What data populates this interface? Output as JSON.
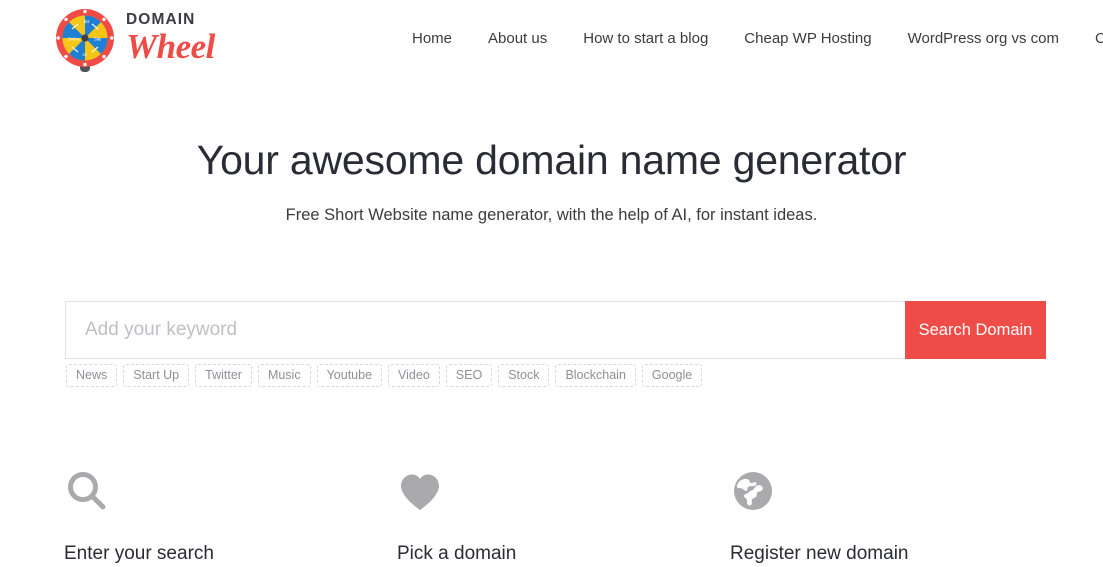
{
  "header": {
    "brand": {
      "word_top": "DOMAIN",
      "word_bottom": "Wheel",
      "logo_icon": "spinning-wheel-icon",
      "colors": {
        "ring": "#ef4b47",
        "segment_yellow": "#f5c518",
        "segment_blue": "#1f7fd4",
        "handle": "#4f5257"
      }
    },
    "nav": [
      {
        "label": "Home"
      },
      {
        "label": "About us"
      },
      {
        "label": "How to start a blog"
      },
      {
        "label": "Cheap WP Hosting"
      },
      {
        "label": "WordPress org vs com"
      },
      {
        "label": "Contact"
      }
    ]
  },
  "hero": {
    "title": "Your awesome domain name generator",
    "subtitle": "Free Short Website name generator, with the help of AI, for instant ideas."
  },
  "search": {
    "placeholder": "Add your keyword",
    "value": "",
    "button_label": "Search Domain",
    "button_color": "#ef4b47"
  },
  "tags": [
    {
      "label": "News"
    },
    {
      "label": "Start Up"
    },
    {
      "label": "Twitter"
    },
    {
      "label": "Music"
    },
    {
      "label": "Youtube"
    },
    {
      "label": "Video"
    },
    {
      "label": "SEO"
    },
    {
      "label": "Stock"
    },
    {
      "label": "Blockchain"
    },
    {
      "label": "Google"
    }
  ],
  "features": [
    {
      "icon": "search-icon",
      "label": "Enter your search"
    },
    {
      "icon": "heart-icon",
      "label": "Pick a domain"
    },
    {
      "icon": "globe-icon",
      "label": "Register new domain"
    }
  ],
  "theme": {
    "accent": "#ef4b47",
    "text_dark": "#2b2b35",
    "text_muted": "#8f8f99",
    "icon_gray": "#aaaaad",
    "border_light": "#e2e2e4"
  }
}
